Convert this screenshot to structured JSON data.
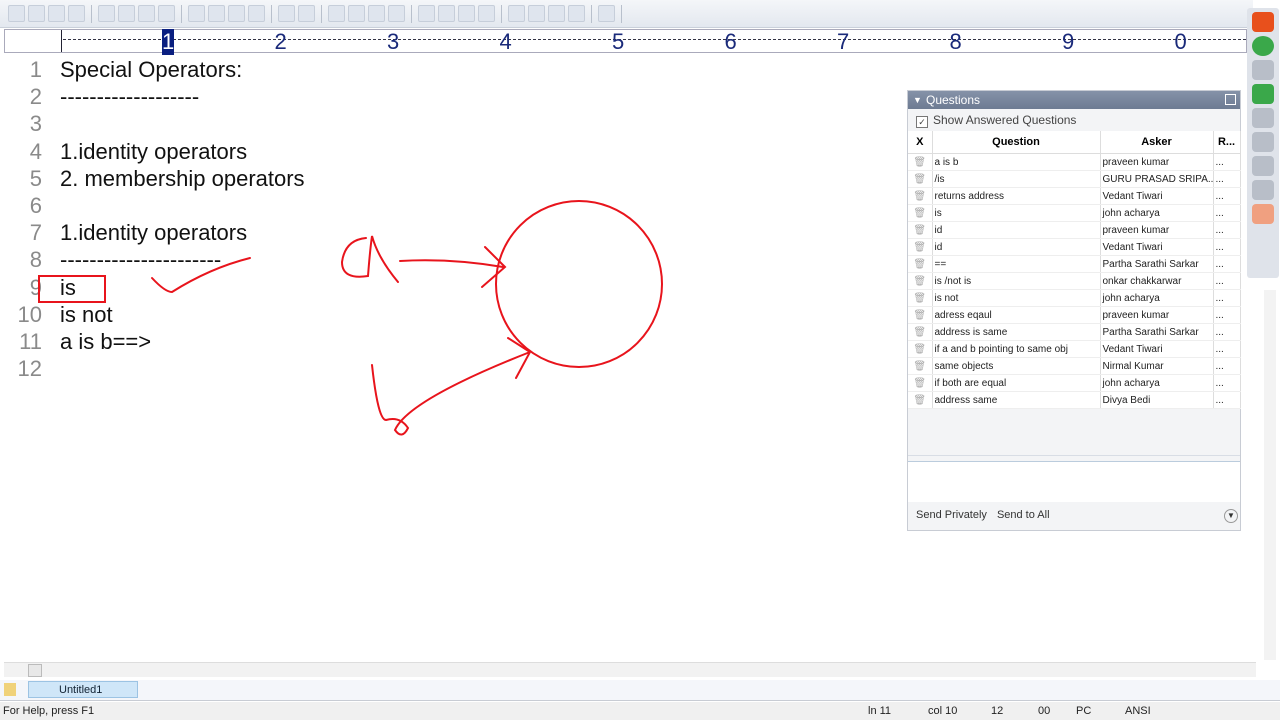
{
  "ruler": {
    "marks": [
      "1",
      "2",
      "3",
      "4",
      "5",
      "6",
      "7",
      "8",
      "9",
      "0"
    ]
  },
  "editor": {
    "lines": [
      {
        "n": "1",
        "text": "Special Operators:"
      },
      {
        "n": "2",
        "text": "-------------------"
      },
      {
        "n": "3",
        "text": ""
      },
      {
        "n": "4",
        "text": "1.identity operators"
      },
      {
        "n": "5",
        "text": "2. membership operators"
      },
      {
        "n": "6",
        "text": ""
      },
      {
        "n": "7",
        "text": "1.identity operators"
      },
      {
        "n": "8",
        "text": "----------------------"
      },
      {
        "n": "9",
        "text": "is"
      },
      {
        "n": "10",
        "text": "is not"
      },
      {
        "n": "11",
        "text": "a is b==>"
      },
      {
        "n": "12",
        "text": ""
      }
    ]
  },
  "annotation_color": "#e8141c",
  "questions": {
    "title": "Questions",
    "show_answered": "Show Answered Questions",
    "columns": [
      "X",
      "Question",
      "Asker",
      "R..."
    ],
    "rows": [
      {
        "q": "a is b",
        "a": "praveen kumar"
      },
      {
        "q": "/is",
        "a": "GURU PRASAD SRIPA..."
      },
      {
        "q": "returns address",
        "a": "Vedant Tiwari"
      },
      {
        "q": "is",
        "a": "john acharya"
      },
      {
        "q": "id",
        "a": "praveen kumar"
      },
      {
        "q": "id",
        "a": "Vedant Tiwari"
      },
      {
        "q": "==",
        "a": "Partha Sarathi Sarkar"
      },
      {
        "q": "is /not is",
        "a": "onkar chakkarwar"
      },
      {
        "q": "is not",
        "a": "john acharya"
      },
      {
        "q": "adress eqaul",
        "a": "praveen kumar"
      },
      {
        "q": "address is same",
        "a": "Partha Sarathi Sarkar"
      },
      {
        "q": "if a and b pointing to same obj",
        "a": "Vedant Tiwari"
      },
      {
        "q": "same objects",
        "a": "Nirmal Kumar"
      },
      {
        "q": "if both are equal",
        "a": "john acharya"
      },
      {
        "q": " address same",
        "a": "Divya Bedi"
      }
    ],
    "more": "...",
    "send_privately": "Send Privately",
    "send_all": "Send to All"
  },
  "tab": {
    "label": "Untitled1"
  },
  "status": {
    "help": "For Help, press F1",
    "ln": "ln 11",
    "col": "col 10",
    "c3": "12",
    "c4": "00",
    "mode": "PC",
    "enc": "ANSI"
  }
}
